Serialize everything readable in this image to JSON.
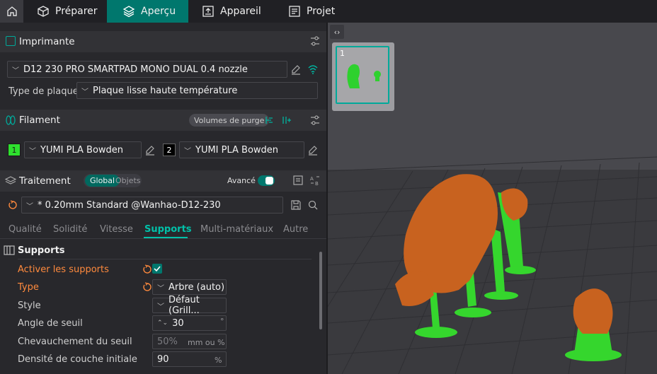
{
  "topbar": {
    "tabs": [
      {
        "label": "Préparer",
        "icon": "cube-icon"
      },
      {
        "label": "Aperçu",
        "icon": "layers-icon",
        "active": true
      },
      {
        "label": "Appareil",
        "icon": "device-icon"
      },
      {
        "label": "Projet",
        "icon": "project-icon"
      }
    ]
  },
  "printer": {
    "title": "Imprimante",
    "name": "D12 230 PRO SMARTPAD MONO DUAL 0.4 nozzle",
    "plate_label": "Type de plaque",
    "plate_value": "Plaque lisse haute température"
  },
  "filament": {
    "title": "Filament",
    "purge_button": "Volumes de purge",
    "slots": [
      {
        "num": "1",
        "name": "YUMI PLA Bowden",
        "color": "#2ee02e"
      },
      {
        "num": "2",
        "name": "YUMI PLA Bowden",
        "color": "#000000"
      }
    ]
  },
  "process": {
    "title": "Traitement",
    "scope_global": "Global",
    "scope_objects": "Objets",
    "advanced_label": "Avancé",
    "advanced_on": true,
    "profile": "* 0.20mm Standard @Wanhao-D12-230",
    "subtabs": [
      "Qualité",
      "Solidité",
      "Vitesse",
      "Supports",
      "Multi-matériaux",
      "Autre"
    ],
    "active_subtab": "Supports"
  },
  "supports": {
    "title": "Supports",
    "rows": [
      {
        "label": "Activer les supports",
        "value": "",
        "unit": ""
      },
      {
        "label": "Type",
        "value": "Arbre (auto)",
        "unit": ""
      },
      {
        "label": "Style",
        "value": "Défaut (Grill...",
        "unit": ""
      },
      {
        "label": "Angle de seuil",
        "value": "30",
        "unit": "°"
      },
      {
        "label": "Chevauchement du seuil",
        "value": "50%",
        "unit": "mm ou %"
      },
      {
        "label": "Densité de couche initiale",
        "value": "90",
        "unit": "%"
      }
    ]
  },
  "viewport": {
    "plate_number": "1"
  },
  "colors": {
    "accent": "#00776d",
    "accent_text": "#00c1a9",
    "warning": "#ff8a3d",
    "model": "#c8621f",
    "support": "#35d62d"
  }
}
